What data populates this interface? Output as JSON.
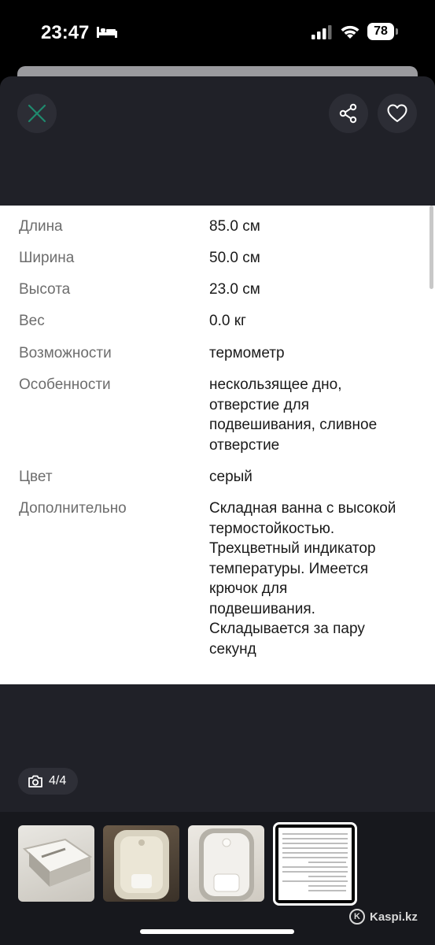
{
  "status_bar": {
    "time": "23:47",
    "battery_level": "78",
    "icons": [
      "bed-icon",
      "signal-icon",
      "wifi-icon",
      "battery-icon"
    ]
  },
  "header": {
    "icons": [
      "close-icon",
      "share-icon",
      "heart-icon"
    ]
  },
  "specs": [
    {
      "label": "Длина",
      "lines": [
        "85.0 см"
      ]
    },
    {
      "label": "Ширина",
      "lines": [
        "50.0 см"
      ]
    },
    {
      "label": "Высота",
      "lines": [
        "23.0 см"
      ]
    },
    {
      "label": "Вес",
      "lines": [
        "0.0 кг"
      ]
    },
    {
      "label": "Возможности",
      "lines": [
        "термометр"
      ]
    },
    {
      "label": "Особенности",
      "lines": [
        "нескользящее дно,",
        "отверстие для",
        "подвешивания, сливное",
        "отверстие"
      ]
    },
    {
      "label": "Цвет",
      "lines": [
        "серый"
      ]
    },
    {
      "label": "Дополнительно",
      "lines": [
        "Складная ванна с высокой",
        "термостойкостью.",
        "Трехцветный индикатор",
        "температуры. Имеется",
        "крючок для",
        "подвешивания.",
        "Складывается за пару",
        "секунд"
      ]
    }
  ],
  "gallery": {
    "counter": "4/4",
    "counter_icon": "camera-icon",
    "selected_index": 4,
    "thumbnail_count": 4
  },
  "watermark": {
    "text": "Kaspi.kz"
  },
  "colors": {
    "modal_bg": "#202128",
    "close_icon": "#1f8a6e",
    "accent_white": "#ffffff"
  }
}
